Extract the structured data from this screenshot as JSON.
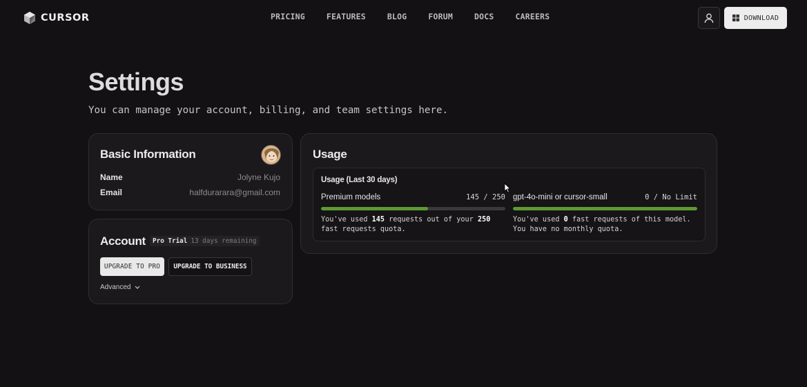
{
  "nav": {
    "brand": "CURSOR",
    "links": [
      "PRICING",
      "FEATURES",
      "BLOG",
      "FORUM",
      "DOCS",
      "CAREERS"
    ],
    "download_label": "DOWNLOAD"
  },
  "header": {
    "title": "Settings",
    "subtitle": "You can manage your account, billing, and team settings here."
  },
  "basic_info": {
    "title": "Basic Information",
    "name_label": "Name",
    "name_value": "Jolyne Kujo",
    "email_label": "Email",
    "email_value": "halfdurarara@gmail.com"
  },
  "account": {
    "title": "Account",
    "plan": "Pro Trial",
    "days_remaining": "13 days remaining",
    "upgrade_pro_label": "UPGRADE TO PRO",
    "upgrade_business_label": "UPGRADE TO BUSINESS",
    "advanced_label": "Advanced"
  },
  "usage": {
    "title": "Usage",
    "period_label": "Usage (Last 30 days)",
    "premium": {
      "name": "Premium models",
      "count": "145 / 250",
      "used": 145,
      "limit": 250,
      "desc_pre": "You've used ",
      "desc_used": "145",
      "desc_mid": " requests out of your ",
      "desc_limit": "250",
      "desc_post": "fast requests quota."
    },
    "mini": {
      "name": "gpt-4o-mini or cursor-small",
      "count": "0 / No Limit",
      "fill_fraction": 1.0,
      "desc_pre": "You've used ",
      "desc_used": "0",
      "desc_mid": " fast requests of this model.",
      "desc_post": "You have no monthly quota."
    }
  },
  "colors": {
    "background": "#131113",
    "card": "#1b191b",
    "progress": "#5d9a31"
  }
}
